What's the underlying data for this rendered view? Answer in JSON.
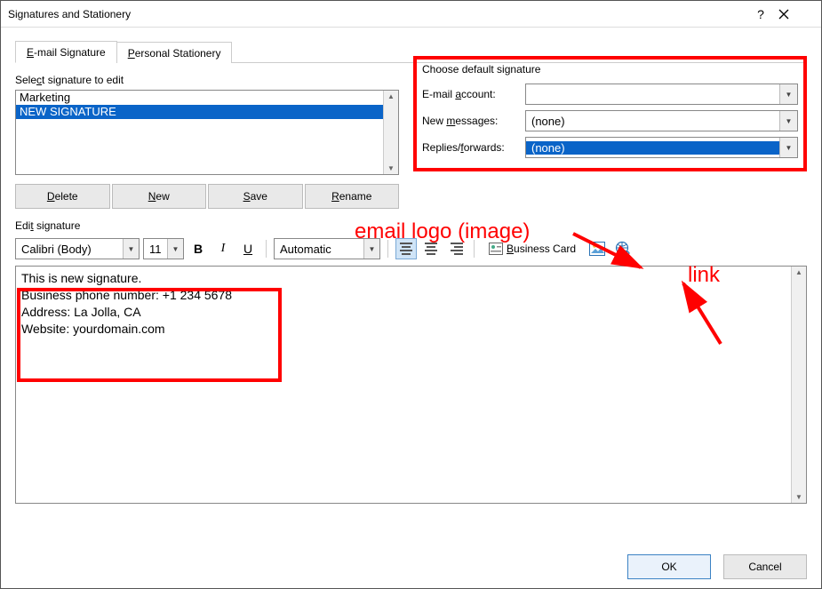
{
  "window": {
    "title": "Signatures and Stationery"
  },
  "tabs": {
    "email": "E-mail Signature",
    "stationery": "Personal Stationery"
  },
  "select_label": "Select signature to edit",
  "signatures": [
    "Marketing",
    "NEW SIGNATURE"
  ],
  "buttons": {
    "delete": "Delete",
    "new": "New",
    "save": "Save",
    "rename": "Rename"
  },
  "default_sig": {
    "title": "Choose default signature",
    "email_label": "E-mail account:",
    "email_value": "",
    "newmsg_label": "New messages:",
    "newmsg_value": "(none)",
    "replies_label": "Replies/forwards:",
    "replies_value": "(none)"
  },
  "edit_label": "Edit signature",
  "toolbar": {
    "font": "Calibri (Body)",
    "size": "11",
    "color": "Automatic",
    "bizcard": "Business Card"
  },
  "signature_text": {
    "l1": "This is new signature.",
    "l2": "Business phone number: +1 234 5678",
    "l3": "Address: La Jolla, CA",
    "l4": "Website: yourdomain.com"
  },
  "footer": {
    "ok": "OK",
    "cancel": "Cancel"
  },
  "annotations": {
    "img_label": "email logo (image)",
    "link_label": "link"
  }
}
